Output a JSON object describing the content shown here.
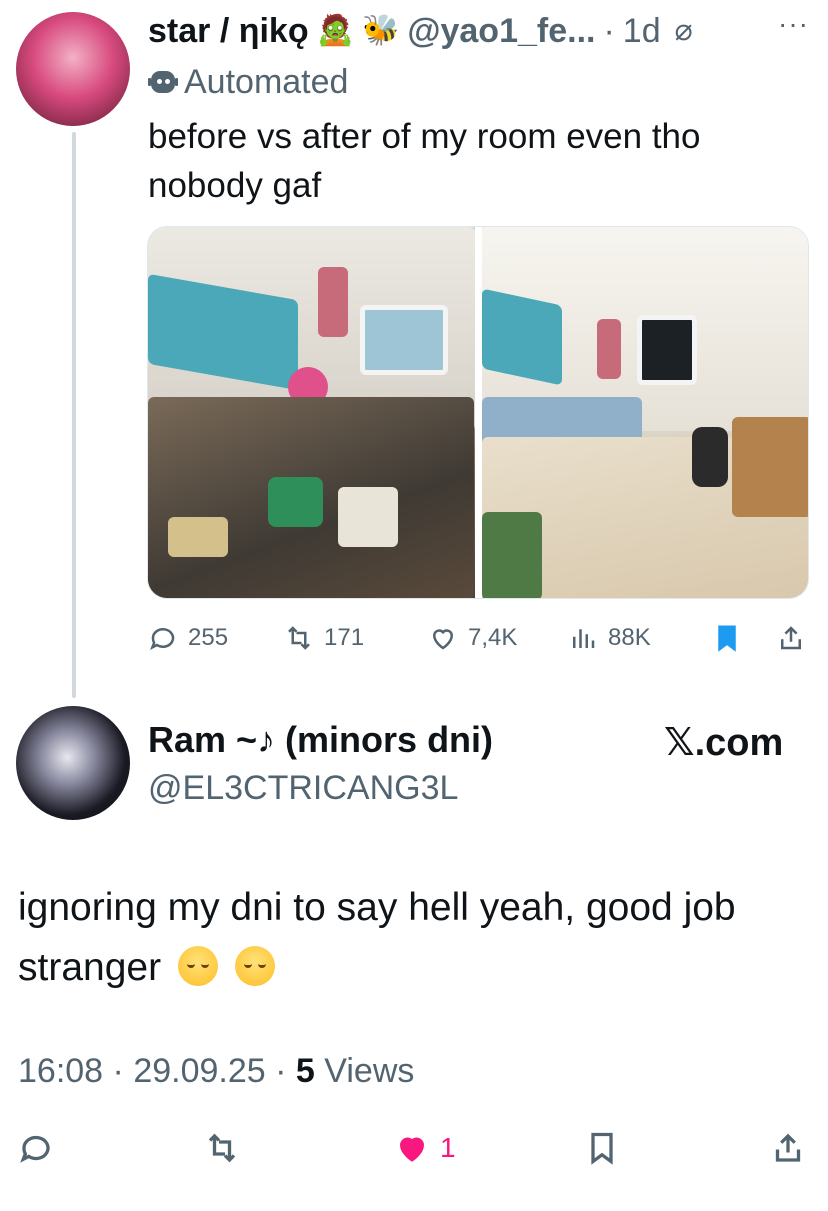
{
  "original_tweet": {
    "display_name": "star / ηikǫ",
    "emojis": [
      "🧟",
      "🐝"
    ],
    "handle": "@yao1_fe...",
    "separator": "·",
    "time": "1d",
    "label": "Automated",
    "text": "before vs after of my room even tho nobody gaf",
    "stats": {
      "replies": "255",
      "reposts": "171",
      "likes": "7,4K",
      "views": "88K"
    },
    "colors": {
      "bookmark_active": "#1d9bf0"
    }
  },
  "reply": {
    "display_name": "Ram ~♪ (minors dni)",
    "handle": "@EL3CTRICANG3L",
    "source": "𝕏.com",
    "text": "ignoring my dni to say hell yeah, good job stranger",
    "time": "16:08",
    "date": "29.09.25",
    "sep1": "·",
    "sep2": "·",
    "views_count": "5",
    "views_label": "Views",
    "likes": "1",
    "colors": {
      "like_active": "#f91880"
    }
  },
  "icons": [
    "slash-icon",
    "more-icon",
    "robot-icon",
    "reply-icon",
    "repost-icon",
    "like-icon",
    "views-icon",
    "bookmark-icon",
    "share-icon"
  ]
}
